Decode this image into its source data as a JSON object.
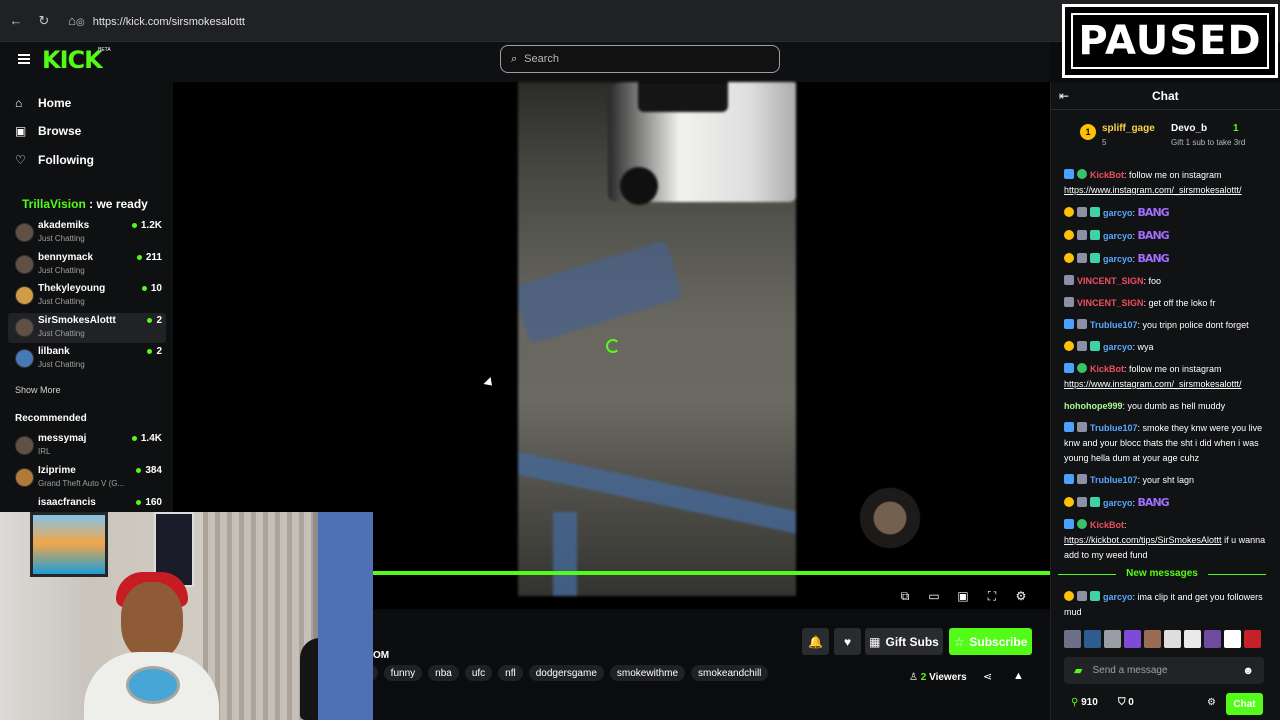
{
  "browser": {
    "url": "https://kick.com/sirsmokesalottt",
    "paused_label": "PAUSED"
  },
  "topbar": {
    "logo": "KICK",
    "beta": "BETA",
    "search_placeholder": "Search"
  },
  "sidebar": {
    "nav": [
      {
        "label": "Home",
        "icon": "home-icon"
      },
      {
        "label": "Browse",
        "icon": "browse-icon"
      },
      {
        "label": "Following",
        "icon": "heart-icon"
      }
    ],
    "following_title": "Following",
    "overlay_name": "TrillaVision",
    "overlay_text": " : we ready",
    "following_channels": [
      {
        "name": "akademiks",
        "category": "Just Chatting",
        "viewers": "1.2K"
      },
      {
        "name": "bennymack",
        "category": "Just Chatting",
        "viewers": "211"
      },
      {
        "name": "Thekyleyoung",
        "category": "Just Chatting",
        "viewers": "10"
      },
      {
        "name": "SirSmokesAlottt",
        "category": "Just Chatting",
        "viewers": "2"
      },
      {
        "name": "lilbank",
        "category": "Just Chatting",
        "viewers": "2"
      }
    ],
    "show_more": "Show More",
    "recommended_title": "Recommended",
    "recommended_channels": [
      {
        "name": "messymaj",
        "category": "IRL",
        "viewers": "1.4K"
      },
      {
        "name": "Iziprime",
        "category": "Grand Theft Auto V (G...",
        "viewers": "384"
      },
      {
        "name": "isaacfrancis",
        "category": "",
        "viewers": "160"
      }
    ]
  },
  "stream": {
    "controls": [
      "miniplayer-icon",
      "theater-icon",
      "pip-icon",
      "fullscreen-icon",
      "settings-icon"
    ],
    "tags": [
      "ill",
      "funny",
      "nba",
      "ufc",
      "nfl",
      "dodgersgame",
      "smokewithme",
      "smokeandchill"
    ],
    "partial_title": "OM",
    "gift_subs": "Gift Subs",
    "subscribe": "Subscribe",
    "viewer_count": "2",
    "viewer_label": "Viewers"
  },
  "chat": {
    "title": "Chat",
    "leaders": [
      {
        "rank": "1",
        "name": "spliff_gage",
        "count": "5"
      },
      {
        "name": "Devo_b",
        "count": "1",
        "subtext": "Gift 1 sub to take 3rd"
      }
    ],
    "messages": [
      {
        "user": "KickBot",
        "text": ": follow me on instagram",
        "link": "https://www.instagram.com/_sirsmokesalottt/"
      },
      {
        "user": "garcyo",
        "text": ":",
        "emote": "BANG"
      },
      {
        "user": "garcyo",
        "text": ":",
        "emote": "BANG"
      },
      {
        "user": "garcyo",
        "text": ":",
        "emote": "BANG"
      },
      {
        "user": "VINCENT_SIGN",
        "text": ": foo"
      },
      {
        "user": "VINCENT_SIGN",
        "text": ": get off the loko fr"
      },
      {
        "user": "Trublue107",
        "text": ": you tripn police dont forget"
      },
      {
        "user": "garcyo",
        "text": ": wya"
      },
      {
        "user": "KickBot",
        "text": ": follow me on instagram",
        "link": "https://www.instagram.com/_sirsmokesalottt/"
      },
      {
        "user": "hohohope999",
        "text": ": you dumb as hell muddy"
      },
      {
        "user": "Trublue107",
        "text": ": smoke they knw were you live knw and your blocc thats the sht i did when i was young hella dum at your age cuhz"
      },
      {
        "user": "Trublue107",
        "text": ": your sht lagn"
      },
      {
        "user": "garcyo",
        "text": ":",
        "emote": "BANG"
      },
      {
        "user": "KickBot",
        "text": ":",
        "link": "https://kickbot.com/tips/SirSmokesAlottt",
        "tail": " if u wanna add to my weed fund"
      }
    ],
    "new_messages": "New messages",
    "last_message": {
      "user": "garcyo",
      "text": ": ima clip it and get you followers mud"
    },
    "input_placeholder": "Send a message",
    "points": "910",
    "bag": "0",
    "send": "Chat"
  }
}
